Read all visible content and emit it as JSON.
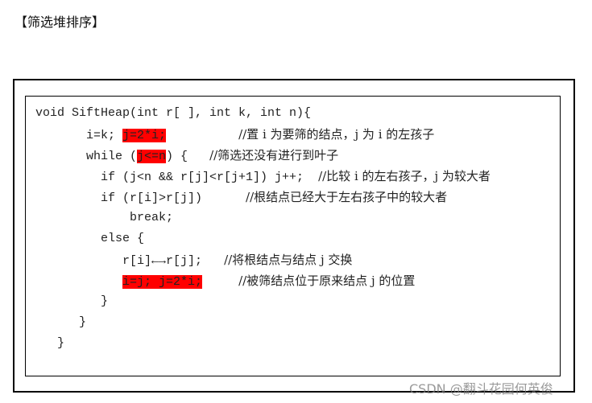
{
  "heading": "【筛选堆排序】",
  "code": [
    {
      "indent": "",
      "pre": "void SiftHeap(int r[ ], int k, int n){",
      "hl": "",
      "post": "",
      "comment": ""
    },
    {
      "indent": "       ",
      "pre": "i=k; ",
      "hl": "j=2*i;",
      "post": "          ",
      "comment": "//置 i 为要筛的结点，j 为 i 的左孩子"
    },
    {
      "indent": "       ",
      "pre": "while (",
      "hl": "j<=n",
      "post": ") {   ",
      "comment": "//筛选还没有进行到叶子"
    },
    {
      "indent": "         ",
      "pre": "if (j<n && r[j]<r[j+1]) j++;  ",
      "hl": "",
      "post": "",
      "comment": "//比较 i 的左右孩子，j 为较大者"
    },
    {
      "indent": "         ",
      "pre": "if (r[i]>r[j])      ",
      "hl": "",
      "post": "",
      "comment": "//根结点已经大于左右孩子中的较大者"
    },
    {
      "indent": "             ",
      "pre": "break;",
      "hl": "",
      "post": "",
      "comment": ""
    },
    {
      "indent": "         ",
      "pre": "else {",
      "hl": "",
      "post": "",
      "comment": ""
    },
    {
      "indent": "            ",
      "pre": "r[i]←→r[j];   ",
      "hl": "",
      "post": "",
      "comment": "//将根结点与结点 j 交换"
    },
    {
      "indent": "            ",
      "pre": "",
      "hl": "i=j; j=2*i;",
      "post": "     ",
      "comment": "//被筛结点位于原来结点 j 的位置"
    },
    {
      "indent": "         ",
      "pre": "}",
      "hl": "",
      "post": "",
      "comment": ""
    },
    {
      "indent": "      ",
      "pre": "}",
      "hl": "",
      "post": "",
      "comment": ""
    },
    {
      "indent": "   ",
      "pre": "}",
      "hl": "",
      "post": "",
      "comment": ""
    }
  ],
  "watermark": "CSDN @翻斗花园何英俊",
  "colors": {
    "highlight": "#ff0000"
  }
}
